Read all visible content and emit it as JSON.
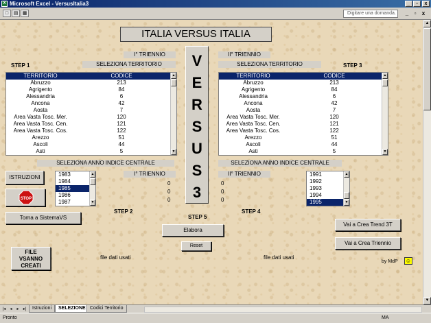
{
  "window": {
    "title": "Microsoft Excel - VersusItalia3",
    "icon_text": "X"
  },
  "toolbar": {
    "ask_placeholder": "Digitare una domanda.",
    "minimize": "_",
    "restore": "▫",
    "close": "x"
  },
  "sheet": {
    "main_title": "ITALIA VERSUS ITALIA",
    "vertical_letters": [
      "V",
      "E",
      "R",
      "S",
      "U",
      "S",
      "3"
    ],
    "left": {
      "step_label": "STEP 1",
      "triennio": "I° TRIENNIO",
      "select_territory": "SELEZIONA TERRITORIO",
      "header": {
        "territorio": "TERRITORIO",
        "codice": "CODICE"
      },
      "rows": [
        [
          "Abruzzo",
          "213"
        ],
        [
          "Agrigento",
          "84"
        ],
        [
          "Alessandria",
          "6"
        ],
        [
          "Ancona",
          "42"
        ],
        [
          "Aosta",
          "7"
        ],
        [
          "Area Vasta Tosc. Mer.",
          "120"
        ],
        [
          "Area Vasta Tosc. Cen.",
          "121"
        ],
        [
          "Area Vasta Tosc. Cos.",
          "122"
        ],
        [
          "Arezzo",
          "51"
        ],
        [
          "Ascoli",
          "44"
        ],
        [
          "Asti",
          "5"
        ]
      ]
    },
    "right": {
      "step_label": "STEP 3",
      "triennio": "II° TRIENNIO",
      "select_territory": "SELEZIONA TERRITORIO",
      "header": {
        "territorio": "TERRITORIO",
        "codice": "CODICE"
      },
      "rows": [
        [
          "Abruzzo",
          "213"
        ],
        [
          "Agrigento",
          "84"
        ],
        [
          "Alessandria",
          "6"
        ],
        [
          "Ancona",
          "42"
        ],
        [
          "Aosta",
          "7"
        ],
        [
          "Area Vasta Tosc. Mer.",
          "120"
        ],
        [
          "Area Vasta Tosc. Cen.",
          "121"
        ],
        [
          "Area Vasta Tosc. Cos.",
          "122"
        ],
        [
          "Arezzo",
          "51"
        ],
        [
          "Ascoli",
          "44"
        ],
        [
          "Asti",
          "5"
        ]
      ]
    },
    "year_left": {
      "label": "SELEZIONA ANNO INDICE CENTRALE",
      "triennio": "I° TRIENNIO",
      "years": [
        "1983",
        "1984",
        "1985",
        "1986",
        "1987"
      ],
      "selected": "1985",
      "values": [
        "0",
        "0",
        "0"
      ]
    },
    "year_right": {
      "label": "SELEZIONA ANNO INDICE CENTRALE",
      "triennio": "II° TRIENNIO",
      "years": [
        "1991",
        "1992",
        "1993",
        "1994",
        "1995"
      ],
      "selected": "1995",
      "values": [
        "0",
        "0",
        "0"
      ]
    },
    "step2": "STEP 2",
    "step4": "STEP 4",
    "step5": "STEP 5",
    "buttons": {
      "istruzioni": "ISTRUZIONI",
      "stop": "STOP",
      "torna": "Torna a SistemaVS",
      "elabora": "Elabora",
      "reset": "Reset",
      "trend": "Vai a Crea Trend 3T",
      "triennio": "Vai a Crea Triennio",
      "file_line1": "FILE",
      "file_line2": "VSANNO",
      "file_line3": "CREATI"
    },
    "file_dati_left": "file dati usati",
    "file_dati_right": "file dati usati",
    "author": "by MdP"
  },
  "tabs": [
    "Istruzioni",
    "SELEZIONE",
    "Codici Territorio"
  ],
  "active_tab": "SELEZIONE",
  "status": {
    "left": "Pronto",
    "right": "MA"
  }
}
